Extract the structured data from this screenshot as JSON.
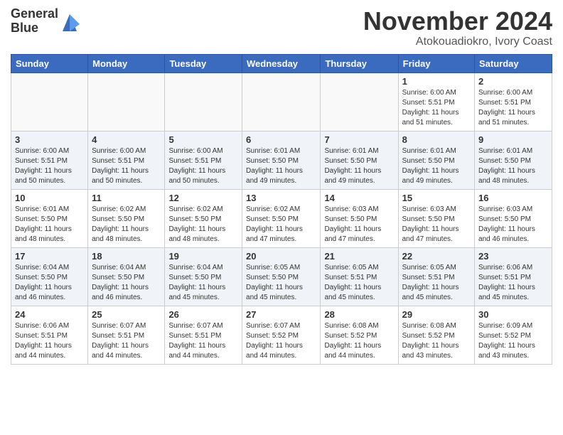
{
  "header": {
    "logo_line1": "General",
    "logo_line2": "Blue",
    "month": "November 2024",
    "location": "Atokouadiokro, Ivory Coast"
  },
  "weekdays": [
    "Sunday",
    "Monday",
    "Tuesday",
    "Wednesday",
    "Thursday",
    "Friday",
    "Saturday"
  ],
  "weeks": [
    [
      {
        "day": "",
        "info": ""
      },
      {
        "day": "",
        "info": ""
      },
      {
        "day": "",
        "info": ""
      },
      {
        "day": "",
        "info": ""
      },
      {
        "day": "",
        "info": ""
      },
      {
        "day": "1",
        "info": "Sunrise: 6:00 AM\nSunset: 5:51 PM\nDaylight: 11 hours\nand 51 minutes."
      },
      {
        "day": "2",
        "info": "Sunrise: 6:00 AM\nSunset: 5:51 PM\nDaylight: 11 hours\nand 51 minutes."
      }
    ],
    [
      {
        "day": "3",
        "info": "Sunrise: 6:00 AM\nSunset: 5:51 PM\nDaylight: 11 hours\nand 50 minutes."
      },
      {
        "day": "4",
        "info": "Sunrise: 6:00 AM\nSunset: 5:51 PM\nDaylight: 11 hours\nand 50 minutes."
      },
      {
        "day": "5",
        "info": "Sunrise: 6:00 AM\nSunset: 5:51 PM\nDaylight: 11 hours\nand 50 minutes."
      },
      {
        "day": "6",
        "info": "Sunrise: 6:01 AM\nSunset: 5:50 PM\nDaylight: 11 hours\nand 49 minutes."
      },
      {
        "day": "7",
        "info": "Sunrise: 6:01 AM\nSunset: 5:50 PM\nDaylight: 11 hours\nand 49 minutes."
      },
      {
        "day": "8",
        "info": "Sunrise: 6:01 AM\nSunset: 5:50 PM\nDaylight: 11 hours\nand 49 minutes."
      },
      {
        "day": "9",
        "info": "Sunrise: 6:01 AM\nSunset: 5:50 PM\nDaylight: 11 hours\nand 48 minutes."
      }
    ],
    [
      {
        "day": "10",
        "info": "Sunrise: 6:01 AM\nSunset: 5:50 PM\nDaylight: 11 hours\nand 48 minutes."
      },
      {
        "day": "11",
        "info": "Sunrise: 6:02 AM\nSunset: 5:50 PM\nDaylight: 11 hours\nand 48 minutes."
      },
      {
        "day": "12",
        "info": "Sunrise: 6:02 AM\nSunset: 5:50 PM\nDaylight: 11 hours\nand 48 minutes."
      },
      {
        "day": "13",
        "info": "Sunrise: 6:02 AM\nSunset: 5:50 PM\nDaylight: 11 hours\nand 47 minutes."
      },
      {
        "day": "14",
        "info": "Sunrise: 6:03 AM\nSunset: 5:50 PM\nDaylight: 11 hours\nand 47 minutes."
      },
      {
        "day": "15",
        "info": "Sunrise: 6:03 AM\nSunset: 5:50 PM\nDaylight: 11 hours\nand 47 minutes."
      },
      {
        "day": "16",
        "info": "Sunrise: 6:03 AM\nSunset: 5:50 PM\nDaylight: 11 hours\nand 46 minutes."
      }
    ],
    [
      {
        "day": "17",
        "info": "Sunrise: 6:04 AM\nSunset: 5:50 PM\nDaylight: 11 hours\nand 46 minutes."
      },
      {
        "day": "18",
        "info": "Sunrise: 6:04 AM\nSunset: 5:50 PM\nDaylight: 11 hours\nand 46 minutes."
      },
      {
        "day": "19",
        "info": "Sunrise: 6:04 AM\nSunset: 5:50 PM\nDaylight: 11 hours\nand 45 minutes."
      },
      {
        "day": "20",
        "info": "Sunrise: 6:05 AM\nSunset: 5:50 PM\nDaylight: 11 hours\nand 45 minutes."
      },
      {
        "day": "21",
        "info": "Sunrise: 6:05 AM\nSunset: 5:51 PM\nDaylight: 11 hours\nand 45 minutes."
      },
      {
        "day": "22",
        "info": "Sunrise: 6:05 AM\nSunset: 5:51 PM\nDaylight: 11 hours\nand 45 minutes."
      },
      {
        "day": "23",
        "info": "Sunrise: 6:06 AM\nSunset: 5:51 PM\nDaylight: 11 hours\nand 45 minutes."
      }
    ],
    [
      {
        "day": "24",
        "info": "Sunrise: 6:06 AM\nSunset: 5:51 PM\nDaylight: 11 hours\nand 44 minutes."
      },
      {
        "day": "25",
        "info": "Sunrise: 6:07 AM\nSunset: 5:51 PM\nDaylight: 11 hours\nand 44 minutes."
      },
      {
        "day": "26",
        "info": "Sunrise: 6:07 AM\nSunset: 5:51 PM\nDaylight: 11 hours\nand 44 minutes."
      },
      {
        "day": "27",
        "info": "Sunrise: 6:07 AM\nSunset: 5:52 PM\nDaylight: 11 hours\nand 44 minutes."
      },
      {
        "day": "28",
        "info": "Sunrise: 6:08 AM\nSunset: 5:52 PM\nDaylight: 11 hours\nand 44 minutes."
      },
      {
        "day": "29",
        "info": "Sunrise: 6:08 AM\nSunset: 5:52 PM\nDaylight: 11 hours\nand 43 minutes."
      },
      {
        "day": "30",
        "info": "Sunrise: 6:09 AM\nSunset: 5:52 PM\nDaylight: 11 hours\nand 43 minutes."
      }
    ]
  ]
}
